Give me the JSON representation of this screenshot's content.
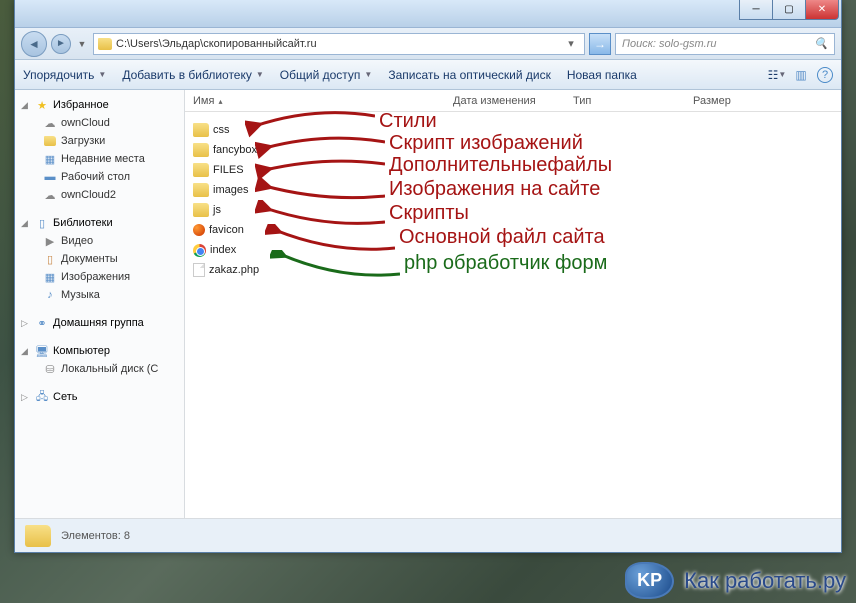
{
  "window": {
    "path": "C:\\Users\\Эльдар\\скопированныйсайт.ru",
    "search_placeholder": "Поиск: solo-gsm.ru"
  },
  "toolbar": {
    "organize": "Упорядочить",
    "library": "Добавить в библиотеку",
    "share": "Общий доступ",
    "burn": "Записать на оптический диск",
    "newfolder": "Новая папка"
  },
  "columns": {
    "name": "Имя",
    "date": "Дата изменения",
    "type": "Тип",
    "size": "Размер"
  },
  "nav": {
    "favorites": "Избранное",
    "fav_items": [
      "ownCloud",
      "Загрузки",
      "Недавние места",
      "Рабочий стол",
      "ownCloud2"
    ],
    "libraries": "Библиотеки",
    "lib_items": [
      "Видео",
      "Документы",
      "Изображения",
      "Музыка"
    ],
    "homegroup": "Домашняя группа",
    "computer": "Компьютер",
    "comp_items": [
      "Локальный диск (C"
    ],
    "network": "Сеть"
  },
  "files": {
    "css": "css",
    "fancybox": "fancybox",
    "FILES": "FILES",
    "images": "images",
    "js": "js",
    "favicon": "favicon",
    "index": "index",
    "zakaz": "zakaz.php"
  },
  "annotations": {
    "a1": "Стили",
    "a2": "Скрипт изображений",
    "a3": "Дополнительныефайлы",
    "a4": "Изображения на сайте",
    "a5": "Скрипты",
    "a6": "Основной файл сайта",
    "a7": "php обработчик форм"
  },
  "status": {
    "text": "Элементов: 8"
  },
  "watermark": {
    "badge": "KP",
    "text": "Как работать.ру"
  }
}
